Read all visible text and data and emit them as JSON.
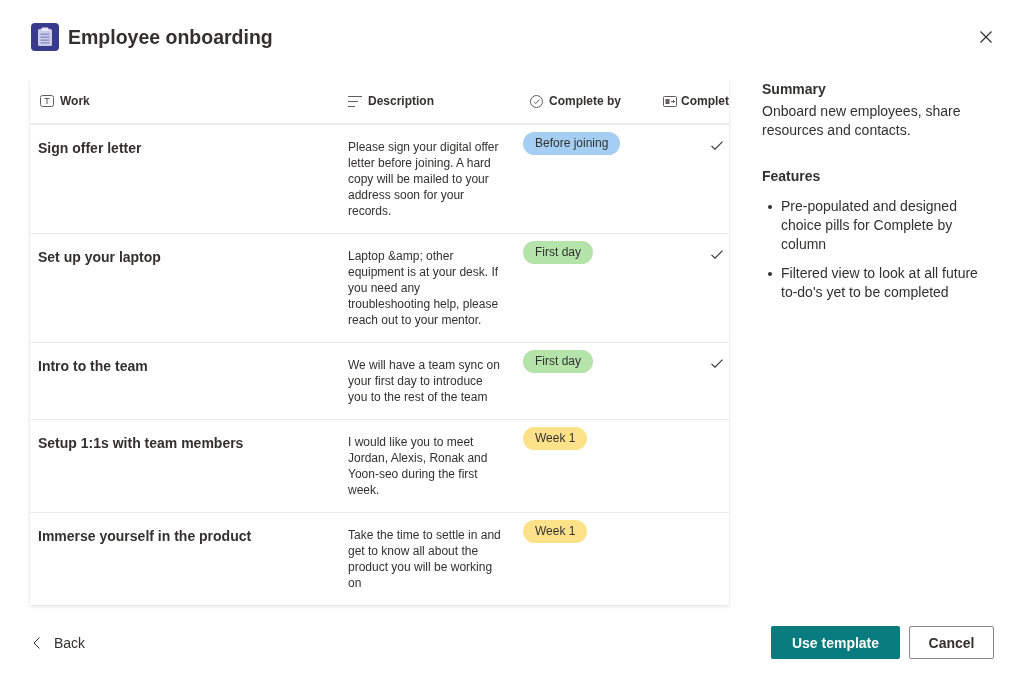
{
  "dialog": {
    "title": "Employee onboarding"
  },
  "table": {
    "columns": [
      {
        "label": "Work",
        "kind": "text"
      },
      {
        "label": "Description",
        "kind": "multiline"
      },
      {
        "label": "Complete by",
        "kind": "choice"
      },
      {
        "label": "Complet",
        "kind": "yesno"
      }
    ],
    "rows": [
      {
        "work": "Sign offer letter",
        "description": "Please sign your digital offer letter before joining. A hard copy will be mailed to your address soon for your records.",
        "complete_by": {
          "label": "Before joining",
          "color": "#a4cff2"
        },
        "checked": true
      },
      {
        "work": "Set up your laptop",
        "description": "Laptop &amp; other equipment is at your desk. If you need any troubleshooting help, please reach out to your mentor.",
        "complete_by": {
          "label": "First day",
          "color": "#b4e4aa"
        },
        "checked": true
      },
      {
        "work": "Intro to the team",
        "description": "We will have a team sync on your first day to introduce you to the rest of the team",
        "complete_by": {
          "label": "First day",
          "color": "#b4e4aa"
        },
        "checked": true
      },
      {
        "work": "Setup 1:1s with team members",
        "description": "I would like you to meet Jordan, Alexis, Ronak and Yoon-seo during the first week.",
        "complete_by": {
          "label": "Week 1",
          "color": "#fee28a"
        },
        "checked": false
      },
      {
        "work": "Immerse yourself in the product",
        "description": "Take the time to settle in and get to know all about the product you will be working on",
        "complete_by": {
          "label": "Week 1",
          "color": "#fee28a"
        },
        "checked": false
      }
    ]
  },
  "summary": {
    "heading": "Summary",
    "text": "Onboard new employees, share resources and contacts."
  },
  "features": {
    "heading": "Features",
    "items": [
      "Pre-populated and designed choice pills for Complete by column",
      "Filtered view to look at all future to-do's yet to be completed"
    ]
  },
  "footer": {
    "back": "Back",
    "primary": "Use template",
    "secondary": "Cancel"
  }
}
